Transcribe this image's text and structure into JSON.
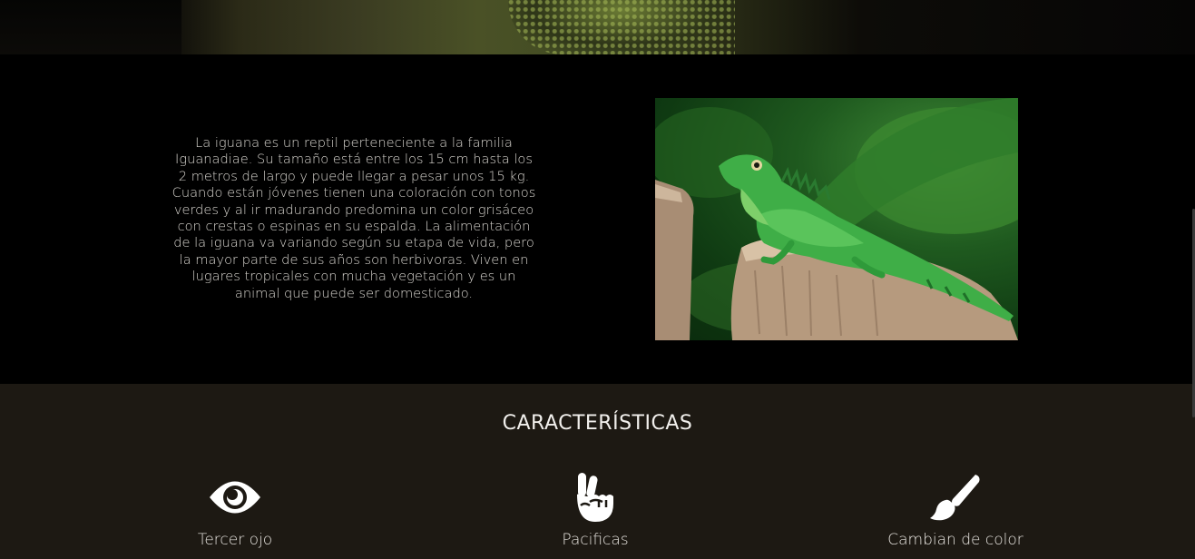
{
  "about": {
    "description": "La iguana es un reptil perteneciente a la familia Iguanadiae. Su tamaño está entre los 15 cm hasta los 2 metros de largo y puede llegar a pesar unos 15 kg. Cuando están jóvenes tienen una coloración con tonos verdes y al ir madurando predomina un color grisáceo con crestas o espinas en su espalda. La alimentación de la iguana va variando según su etapa de vida, pero la mayor parte de sus años son herbivoras. Viven en lugares tropicales con mucha vegetación y es un animal que puede ser domesticado.",
    "photo_subject": "green-iguana-on-tree-stump"
  },
  "features": {
    "title": "CARACTERÍSTICAS",
    "items": [
      {
        "label": "Tercer ojo",
        "icon": "eye-icon"
      },
      {
        "label": "Pacificas",
        "icon": "peace-hand-icon"
      },
      {
        "label": "Cambian de color",
        "icon": "paint-brush-icon"
      }
    ]
  },
  "colors": {
    "page_bg": "#000000",
    "features_bg": "#1d1913",
    "text": "#e8e6e3"
  }
}
